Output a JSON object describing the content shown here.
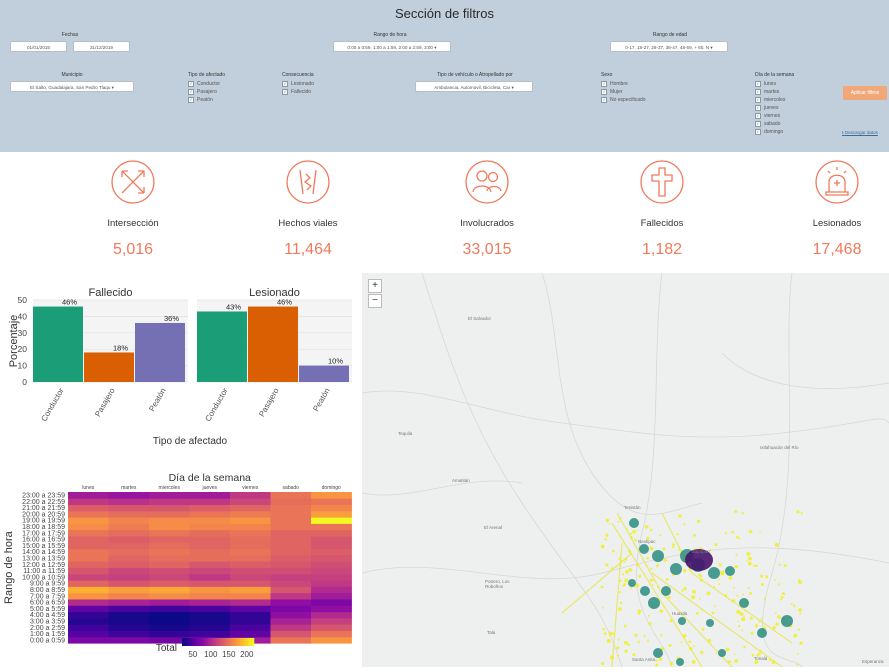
{
  "filters": {
    "title": "Sección de filtros",
    "fechas": {
      "label": "Fechas",
      "start": "01/01/2015",
      "end": "31/12/2019"
    },
    "rango_hora": {
      "label": "Rango de hora",
      "value": "0:00 a 0:59, 1:00 a 1:59, 2:00 a 2:59, 3:00 ▾"
    },
    "rango_edad": {
      "label": "Rango de edad",
      "value": "0-17, 18-27, 28-37, 38-47, 48-59, + 60, N ▾"
    },
    "municipio": {
      "label": "Municipio",
      "value": "El Salto, Guadalajara, San Pedro Tlaqu ▾"
    },
    "tipo_afectado": {
      "label": "Tipo de afectado",
      "options": [
        "Conductor",
        "Pasajero",
        "Peatón"
      ]
    },
    "consecuencia": {
      "label": "Consecuencia",
      "options": [
        "Lesionado",
        "Fallecido"
      ]
    },
    "tipo_vehiculo": {
      "label": "Tipo de vehículo o Atropellado por",
      "value": "Ambulancia, Automovil, Bicicleta, Car ▾"
    },
    "sexo": {
      "label": "Sexo",
      "options": [
        "Hombre",
        "Mujer",
        "No especificado"
      ]
    },
    "dia_semana": {
      "label": "Día de la semana",
      "options": [
        "lunes",
        "martes",
        "miercoles",
        "jueves",
        "viernes",
        "sabado",
        "domingo"
      ]
    },
    "apply_label": "Aplicar filtros",
    "download_label": "Descargar datos"
  },
  "kpis": [
    {
      "icon": "intersection-icon",
      "label": "Intersección",
      "value": "5,016"
    },
    {
      "icon": "road-incident-icon",
      "label": "Hechos viales",
      "value": "11,464"
    },
    {
      "icon": "people-icon",
      "label": "Involucrados",
      "value": "33,015"
    },
    {
      "icon": "cross-icon",
      "label": "Fallecidos",
      "value": "1,182"
    },
    {
      "icon": "siren-icon",
      "label": "Lesionados",
      "value": "17,468"
    }
  ],
  "colors": {
    "accent": "#ef7a5d",
    "filter_bg": "#c1cedb",
    "conductor": "#1b9e77",
    "pasajero": "#d95f02",
    "peaton": "#7570b3"
  },
  "chart_data": [
    {
      "type": "bar",
      "panels": [
        "Fallecido",
        "Lesionado"
      ],
      "categories": [
        "Conductor",
        "Pasajero",
        "Peatón"
      ],
      "series": [
        {
          "name": "Fallecido",
          "values": [
            46,
            18,
            36
          ]
        },
        {
          "name": "Lesionado",
          "values": [
            43,
            46,
            10
          ]
        }
      ],
      "value_labels": {
        "Fallecido": [
          "46%",
          "18%",
          "36%"
        ],
        "Lesionado": [
          "43%",
          "46%",
          "10%"
        ]
      },
      "ylabel": "Porcentaje",
      "xlabel": "Tipo de afectado",
      "ylim": [
        0,
        50
      ],
      "yticks": [
        0,
        10,
        20,
        30,
        40,
        50
      ]
    },
    {
      "type": "heatmap",
      "title": "Día de la semana",
      "xlabel": "",
      "ylabel": "Rango de hora",
      "x": [
        "lunes",
        "martes",
        "miercoles",
        "jueves",
        "viernes",
        "sabado",
        "domingo"
      ],
      "y": [
        "0:00 a 0:59",
        "1:00 a 1:59",
        "2:00 a 2:59",
        "3:00 a 3:59",
        "4:00 a 4:59",
        "5:00 a 5:59",
        "6:00 a 6:59",
        "7:00 a 7:59",
        "8:00 a 8:59",
        "9:00 a 9:59",
        "10:00 a 10:59",
        "11:00 a 11:59",
        "12:00 a 12:59",
        "13:00 a 13:59",
        "14:00 a 14:59",
        "15:00 a 15:59",
        "16:00 a 16:59",
        "17:00 a 17:59",
        "18:00 a 18:59",
        "19:00 a 19:59",
        "20:00 a 20:59",
        "21:00 a 21:59",
        "22:00 a 22:59",
        "23:00 a 23:59"
      ],
      "values": [
        [
          70,
          70,
          65,
          70,
          90,
          150,
          170
        ],
        [
          50,
          40,
          35,
          40,
          55,
          130,
          150
        ],
        [
          40,
          30,
          25,
          30,
          45,
          110,
          130
        ],
        [
          30,
          25,
          20,
          25,
          35,
          95,
          115
        ],
        [
          35,
          25,
          20,
          25,
          35,
          80,
          100
        ],
        [
          55,
          45,
          40,
          45,
          55,
          70,
          80
        ],
        [
          100,
          95,
          90,
          95,
          100,
          80,
          70
        ],
        [
          170,
          160,
          165,
          160,
          160,
          110,
          90
        ],
        [
          185,
          175,
          180,
          170,
          175,
          130,
          100
        ],
        [
          140,
          130,
          135,
          130,
          130,
          120,
          110
        ],
        [
          120,
          115,
          120,
          110,
          120,
          115,
          115
        ],
        [
          130,
          120,
          125,
          120,
          125,
          125,
          120
        ],
        [
          140,
          135,
          140,
          130,
          135,
          130,
          125
        ],
        [
          150,
          140,
          145,
          145,
          145,
          135,
          130
        ],
        [
          150,
          145,
          150,
          145,
          150,
          140,
          135
        ],
        [
          140,
          140,
          145,
          140,
          145,
          140,
          130
        ],
        [
          140,
          135,
          140,
          140,
          145,
          140,
          130
        ],
        [
          150,
          145,
          150,
          145,
          150,
          140,
          140
        ],
        [
          165,
          155,
          165,
          160,
          160,
          150,
          150
        ],
        [
          170,
          160,
          165,
          165,
          170,
          150,
          220
        ],
        [
          150,
          145,
          145,
          150,
          155,
          150,
          175
        ],
        [
          135,
          130,
          130,
          135,
          140,
          150,
          160
        ],
        [
          110,
          105,
          110,
          110,
          120,
          145,
          150
        ],
        [
          90,
          85,
          90,
          90,
          110,
          150,
          170
        ]
      ],
      "colorbar": {
        "label": "Total",
        "ticks": [
          50,
          100,
          150,
          200
        ],
        "range": [
          20,
          220
        ]
      }
    }
  ],
  "map": {
    "zoom_in": "+",
    "zoom_out": "−",
    "places": [
      "El Salvador",
      "Tequila",
      "Amatitán",
      "El Arenal",
      "Ixtlahuacán del Río",
      "Nextipac",
      "Tesistán",
      "Zapopan",
      "Tala",
      "Huaxtla",
      "Potrero, Los Ruboños",
      "Tonalá",
      "Santa Anita",
      "Esperanza"
    ]
  }
}
